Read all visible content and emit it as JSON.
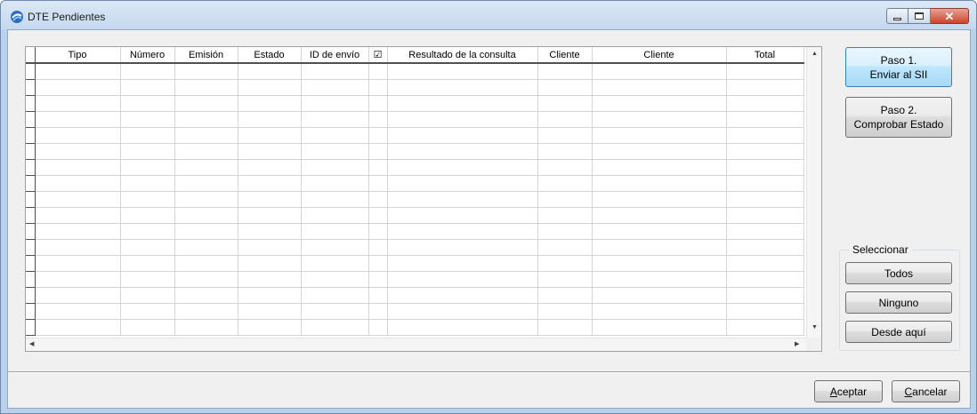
{
  "window": {
    "title": "DTE Pendientes"
  },
  "grid": {
    "columns": [
      "Tipo",
      "Número",
      "Emisión",
      "Estado",
      "ID de envío",
      "☑",
      "Resultado de la consulta",
      "Cliente",
      "Cliente",
      "Total"
    ],
    "empty_rows": 17
  },
  "buttons": {
    "step1": [
      "Paso 1.",
      "Enviar al SII"
    ],
    "step2": [
      "Paso 2.",
      "Comprobar Estado"
    ]
  },
  "select_group": {
    "label": "Seleccionar",
    "all": "Todos",
    "none": "Ninguno",
    "from_here": "Desde aquí"
  },
  "footer": {
    "accept_first": "A",
    "accept_rest": "ceptar",
    "cancel_first": "C",
    "cancel_rest": "ancelar"
  },
  "icons": [
    "app-icon",
    "minimize-icon",
    "maximize-icon",
    "close-icon",
    "scroll-up-icon",
    "scroll-down-icon",
    "scroll-left-icon",
    "scroll-right-icon"
  ]
}
